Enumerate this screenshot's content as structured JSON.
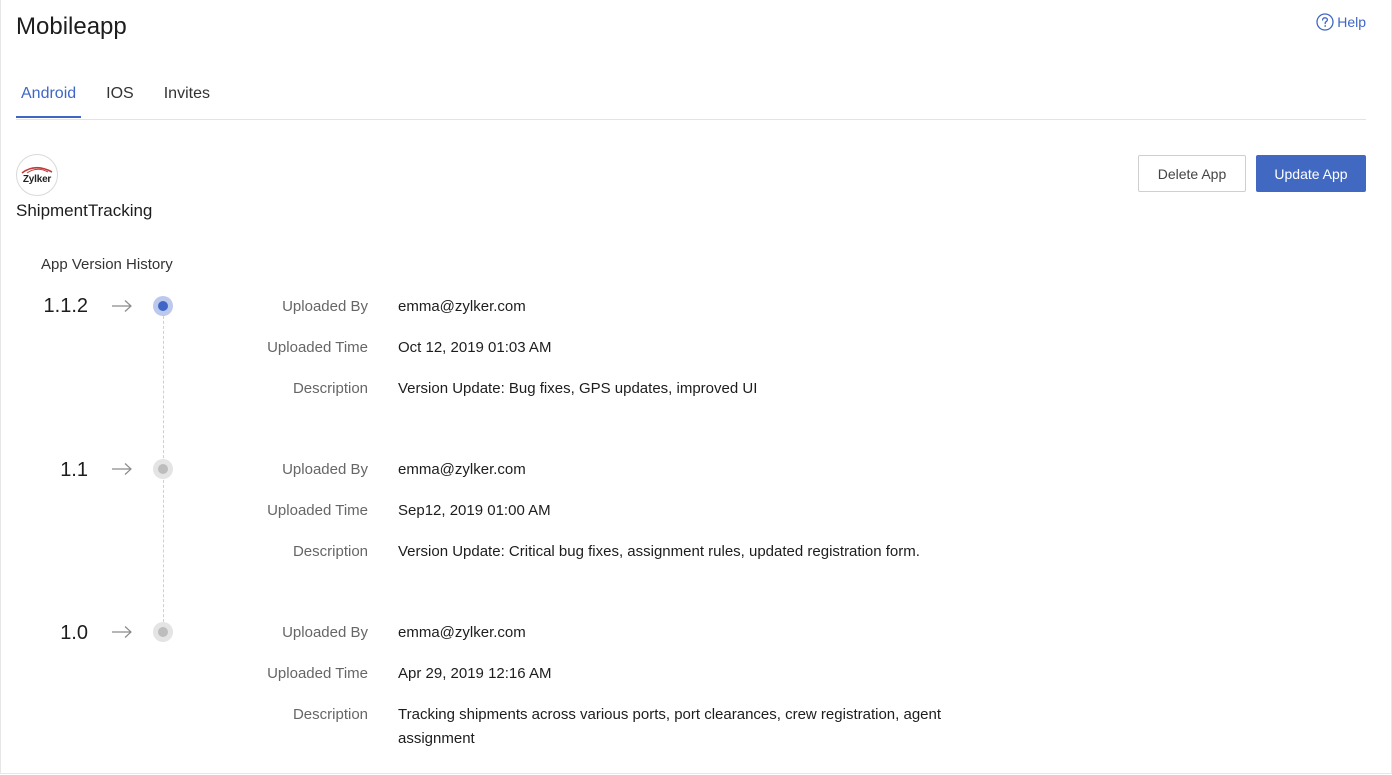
{
  "header": {
    "title": "Mobileapp",
    "help_label": "Help"
  },
  "tabs": [
    {
      "label": "Android",
      "active": true
    },
    {
      "label": "IOS",
      "active": false
    },
    {
      "label": "Invites",
      "active": false
    }
  ],
  "app": {
    "logo_text": "Zylker",
    "name": "ShipmentTracking"
  },
  "actions": {
    "delete_label": "Delete App",
    "update_label": "Update App"
  },
  "history": {
    "title": "App Version History",
    "field_labels": {
      "uploaded_by": "Uploaded By",
      "uploaded_time": "Uploaded Time",
      "description": "Description"
    },
    "versions": [
      {
        "version": "1.1.2",
        "current": true,
        "uploaded_by": "emma@zylker.com",
        "uploaded_time": "Oct 12, 2019 01:03 AM",
        "description": "Version Update: Bug fixes, GPS updates, improved UI"
      },
      {
        "version": "1.1",
        "current": false,
        "uploaded_by": "emma@zylker.com",
        "uploaded_time": "Sep12, 2019 01:00 AM",
        "description": "Version Update: Critical bug fixes, assignment rules, updated registration form."
      },
      {
        "version": "1.0",
        "current": false,
        "uploaded_by": "emma@zylker.com",
        "uploaded_time": "Apr 29, 2019 12:16 AM",
        "description": "Tracking shipments across various ports, port clearances, crew registration, agent assignment"
      }
    ]
  },
  "colors": {
    "accent": "#3f66c6",
    "primary_button": "#4169c1",
    "active_dot_halo": "#bcc9ec",
    "inactive_dot": "#bdbdbd"
  },
  "icons": {
    "help": "question-circle-icon",
    "arrow": "arrow-right-icon",
    "logo": "zylker-logo"
  }
}
